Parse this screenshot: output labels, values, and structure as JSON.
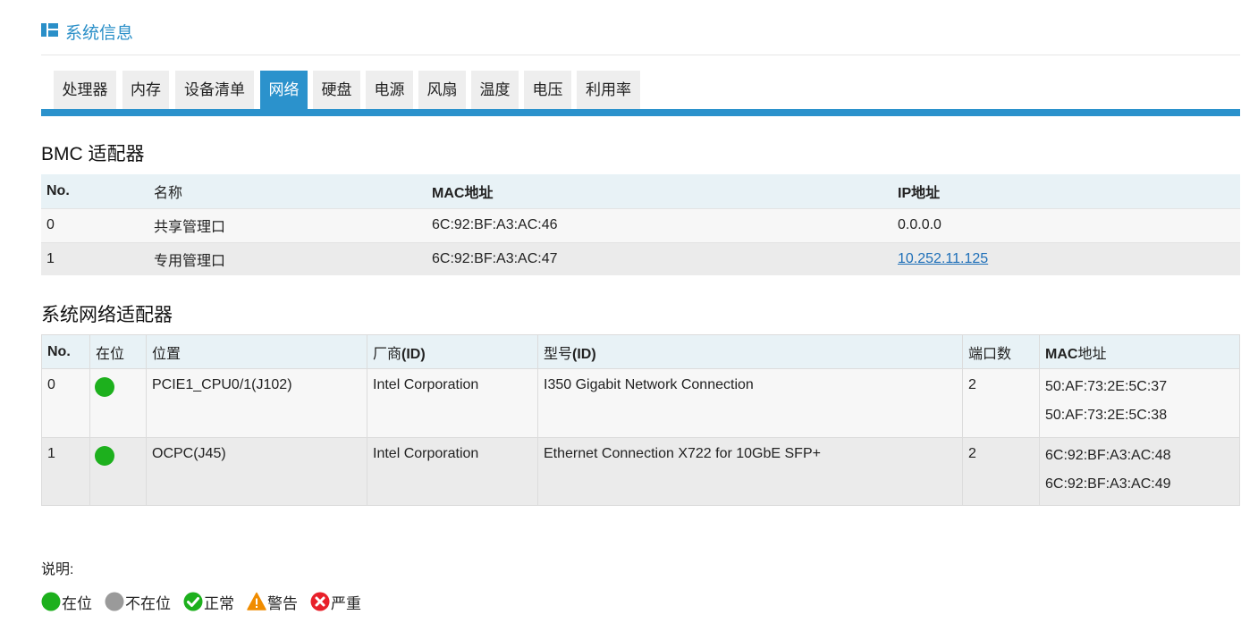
{
  "header": {
    "title": "系统信息",
    "icon": "panel-icon"
  },
  "tabs": [
    {
      "label": "处理器",
      "active": false
    },
    {
      "label": "内存",
      "active": false
    },
    {
      "label": "设备清单",
      "active": false
    },
    {
      "label": "网络",
      "active": true
    },
    {
      "label": "硬盘",
      "active": false
    },
    {
      "label": "电源",
      "active": false
    },
    {
      "label": "风扇",
      "active": false
    },
    {
      "label": "温度",
      "active": false
    },
    {
      "label": "电压",
      "active": false
    },
    {
      "label": "利用率",
      "active": false
    }
  ],
  "bmc": {
    "title": "BMC 适配器",
    "columns": {
      "no": "No.",
      "name": "名称",
      "mac": "MAC地址",
      "ip": "IP地址"
    },
    "rows": [
      {
        "no": "0",
        "name": "共享管理口",
        "mac": "6C:92:BF:A3:AC:46",
        "ip": "0.0.0.0"
      },
      {
        "no": "1",
        "name": "专用管理口",
        "mac": "6C:92:BF:A3:AC:47",
        "ip": "10.252.11.125"
      }
    ]
  },
  "sys": {
    "title": "系统网络适配器",
    "columns": {
      "no": "No.",
      "present": "在位",
      "location": "位置",
      "vendor": "厂商",
      "vendor_id": "(ID)",
      "model": "型号",
      "model_id": "(ID)",
      "ports": "端口数",
      "mac": "MAC地址"
    },
    "rows": [
      {
        "no": "0",
        "present": true,
        "location": "PCIE1_CPU0/1(J102)",
        "vendor": "Intel Corporation",
        "model": "I350 Gigabit Network Connection",
        "ports": "2",
        "macs": [
          "50:AF:73:2E:5C:37",
          "50:AF:73:2E:5C:38"
        ]
      },
      {
        "no": "1",
        "present": true,
        "location": "OCPC(J45)",
        "vendor": "Intel Corporation",
        "model": "Ethernet Connection X722 for 10GbE SFP+",
        "ports": "2",
        "macs": [
          "6C:92:BF:A3:AC:48",
          "6C:92:BF:A3:AC:49"
        ]
      }
    ]
  },
  "legend": {
    "label": "说明:",
    "items": [
      {
        "icon": "present-dot-icon",
        "label": "在位",
        "color": "#1db01d"
      },
      {
        "icon": "absent-dot-icon",
        "label": "不在位",
        "color": "#9a9a9a"
      },
      {
        "icon": "ok-check-icon",
        "label": "正常",
        "color": "#1db01d"
      },
      {
        "icon": "warning-triangle-icon",
        "label": "警告",
        "color": "#f08c00"
      },
      {
        "icon": "critical-x-icon",
        "label": "严重",
        "color": "#e8202a"
      }
    ]
  },
  "colors": {
    "accent": "#2b92cc",
    "link": "#1e6fb8",
    "present": "#1db01d"
  }
}
